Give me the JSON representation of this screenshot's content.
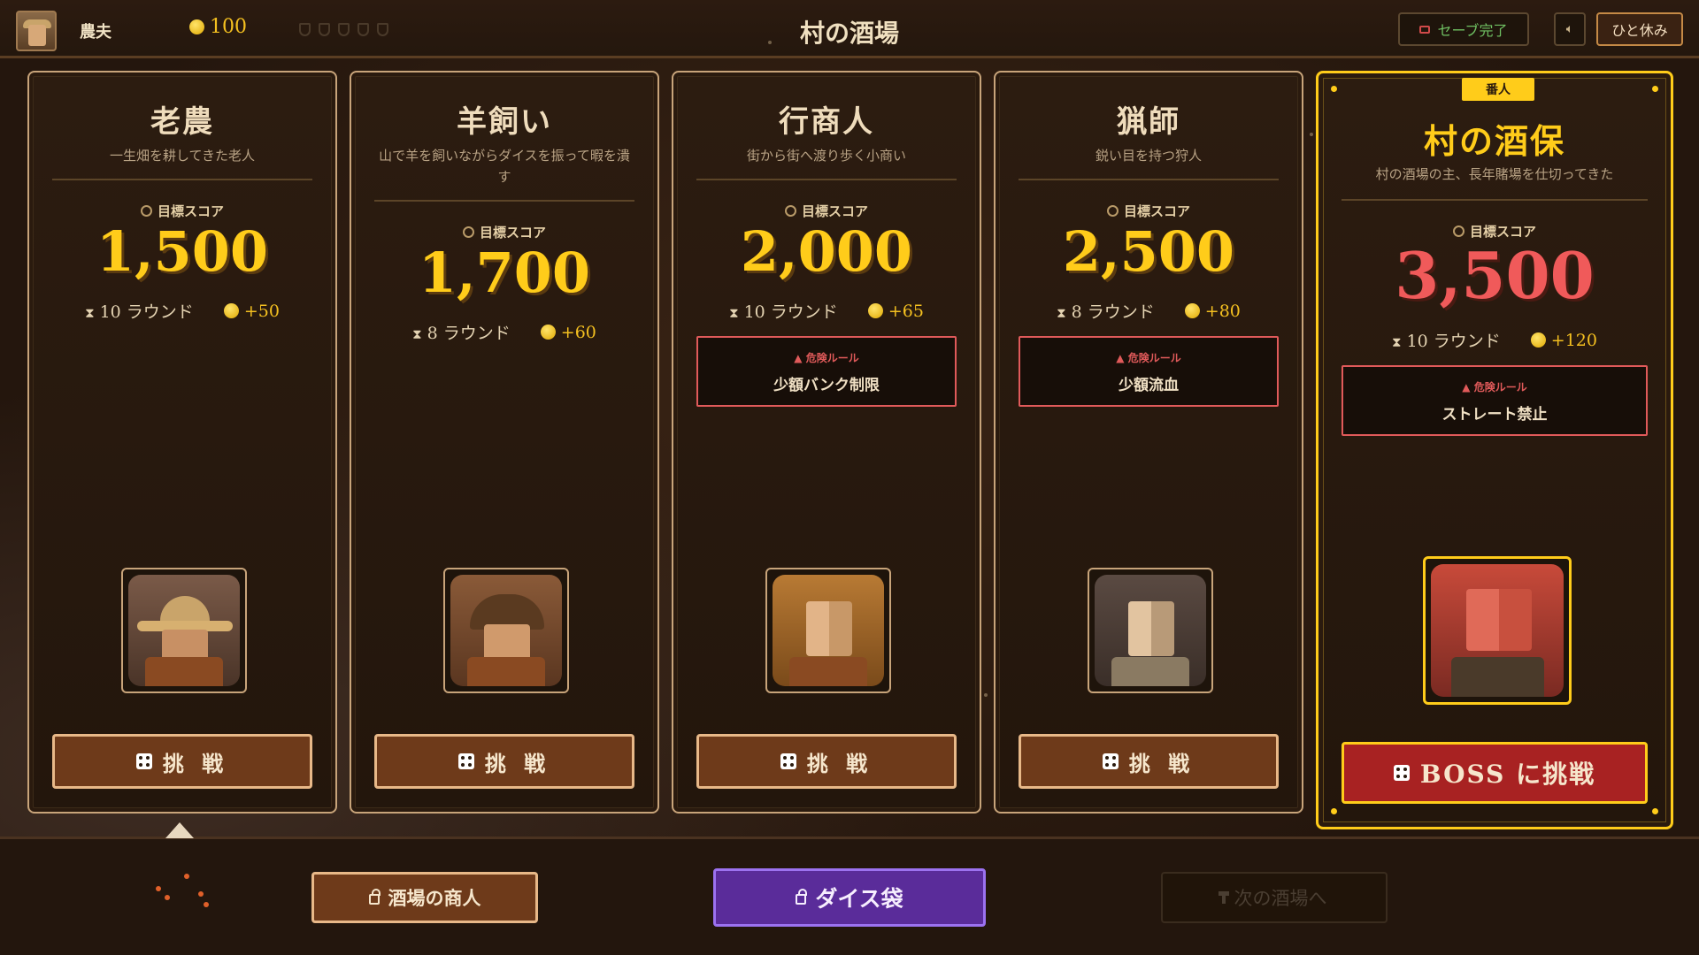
{
  "header": {
    "player_name": "農夫",
    "gold": "100",
    "title": "村の酒場",
    "save_status": "セーブ完了",
    "rest_label": "ひと休み"
  },
  "cards": [
    {
      "name": "老農",
      "description": "一生畑を耕してきた老人",
      "target_label": "目標スコア",
      "target_score": "1,500",
      "rounds": "10 ラウンド",
      "reward": "+50",
      "danger_label": "",
      "danger_rule": "",
      "button_label": "挑 戦"
    },
    {
      "name": "羊飼い",
      "description": "山で羊を飼いながらダイスを振って暇を潰す",
      "target_label": "目標スコア",
      "target_score": "1,700",
      "rounds": "8 ラウンド",
      "reward": "+60",
      "danger_label": "",
      "danger_rule": "",
      "button_label": "挑 戦"
    },
    {
      "name": "行商人",
      "description": "街から街へ渡り歩く小商い",
      "target_label": "目標スコア",
      "target_score": "2,000",
      "rounds": "10 ラウンド",
      "reward": "+65",
      "danger_label": "危険ルール",
      "danger_rule": "少額バンク制限",
      "button_label": "挑 戦"
    },
    {
      "name": "猟師",
      "description": "鋭い目を持つ狩人",
      "target_label": "目標スコア",
      "target_score": "2,500",
      "rounds": "8 ラウンド",
      "reward": "+80",
      "danger_label": "危険ルール",
      "danger_rule": "少額流血",
      "button_label": "挑 戦"
    },
    {
      "boss_tag": "番人",
      "name": "村の酒保",
      "description": "村の酒場の主、長年賭場を仕切ってきた",
      "target_label": "目標スコア",
      "target_score": "3,500",
      "rounds": "10 ラウンド",
      "reward": "+120",
      "danger_label": "危険ルール",
      "danger_rule": "ストレート禁止",
      "button_label": "BOSS に挑戦"
    }
  ],
  "footer": {
    "merchant_label": "酒場の商人",
    "dicebag_label": "ダイス袋",
    "next_label": "次の酒場へ"
  },
  "colors": {
    "accent_gold": "#ffcc1a",
    "boss_score": "#f05a5a",
    "danger": "#e05a5a",
    "dicebag": "#5a2c9a"
  }
}
